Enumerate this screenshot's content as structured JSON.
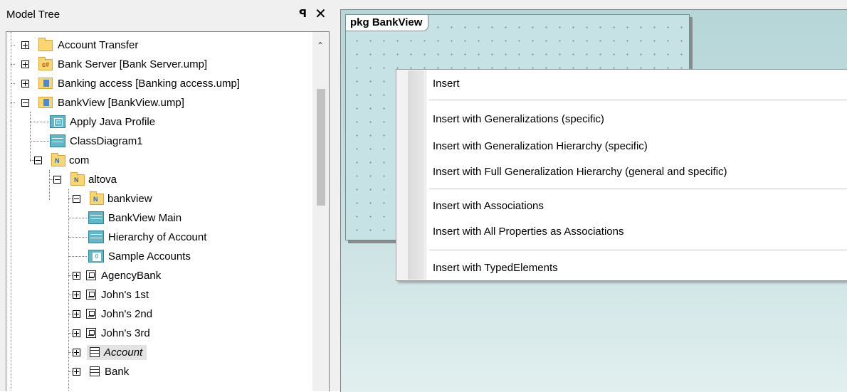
{
  "model_tree": {
    "title": "Model Tree",
    "pin_icon": "pin-icon",
    "close_icon": "close-icon",
    "items": [
      {
        "label": "Account Transfer",
        "icon": "folder-icon"
      },
      {
        "label": "Bank Server [Bank Server.ump]",
        "icon": "csharp-project-icon"
      },
      {
        "label": "Banking access [Banking access.ump]",
        "icon": "project-folder-icon"
      },
      {
        "label": "BankView [BankView.ump]",
        "icon": "project-folder-icon"
      },
      {
        "label": "Apply Java Profile",
        "icon": "profile-diagram-icon"
      },
      {
        "label": "ClassDiagram1",
        "icon": "class-diagram-icon"
      },
      {
        "label": "com",
        "icon": "namespace-folder-icon"
      },
      {
        "label": "altova",
        "icon": "namespace-folder-icon"
      },
      {
        "label": "bankview",
        "icon": "namespace-folder-icon"
      },
      {
        "label": "BankView Main",
        "icon": "class-diagram-icon"
      },
      {
        "label": "Hierarchy of Account",
        "icon": "class-diagram-icon"
      },
      {
        "label": "Sample Accounts",
        "icon": "object-diagram-icon"
      },
      {
        "label": "AgencyBank",
        "icon": "instance-icon"
      },
      {
        "label": "John's 1st",
        "icon": "instance-icon"
      },
      {
        "label": "John's 2nd",
        "icon": "instance-icon"
      },
      {
        "label": "John's 3rd",
        "icon": "instance-icon"
      },
      {
        "label": "Account",
        "icon": "class-icon",
        "selected": true
      },
      {
        "label": "Bank",
        "icon": "class-icon"
      }
    ],
    "folder_glyph_csharp": "c#",
    "folder_glyph_namespace": "N",
    "profile_glyph": "⊡",
    "objdiag_glyph": "0"
  },
  "diagram": {
    "package_label": "pkg BankView"
  },
  "context_menu": {
    "items": [
      "Insert",
      "Insert with Generalizations (specific)",
      "Insert with Generalization Hierarchy (specific)",
      "Insert with Full Generalization Hierarchy (general and specific)",
      "Insert with Associations",
      "Insert with All Properties as Associations",
      "Insert with TypedElements"
    ]
  }
}
